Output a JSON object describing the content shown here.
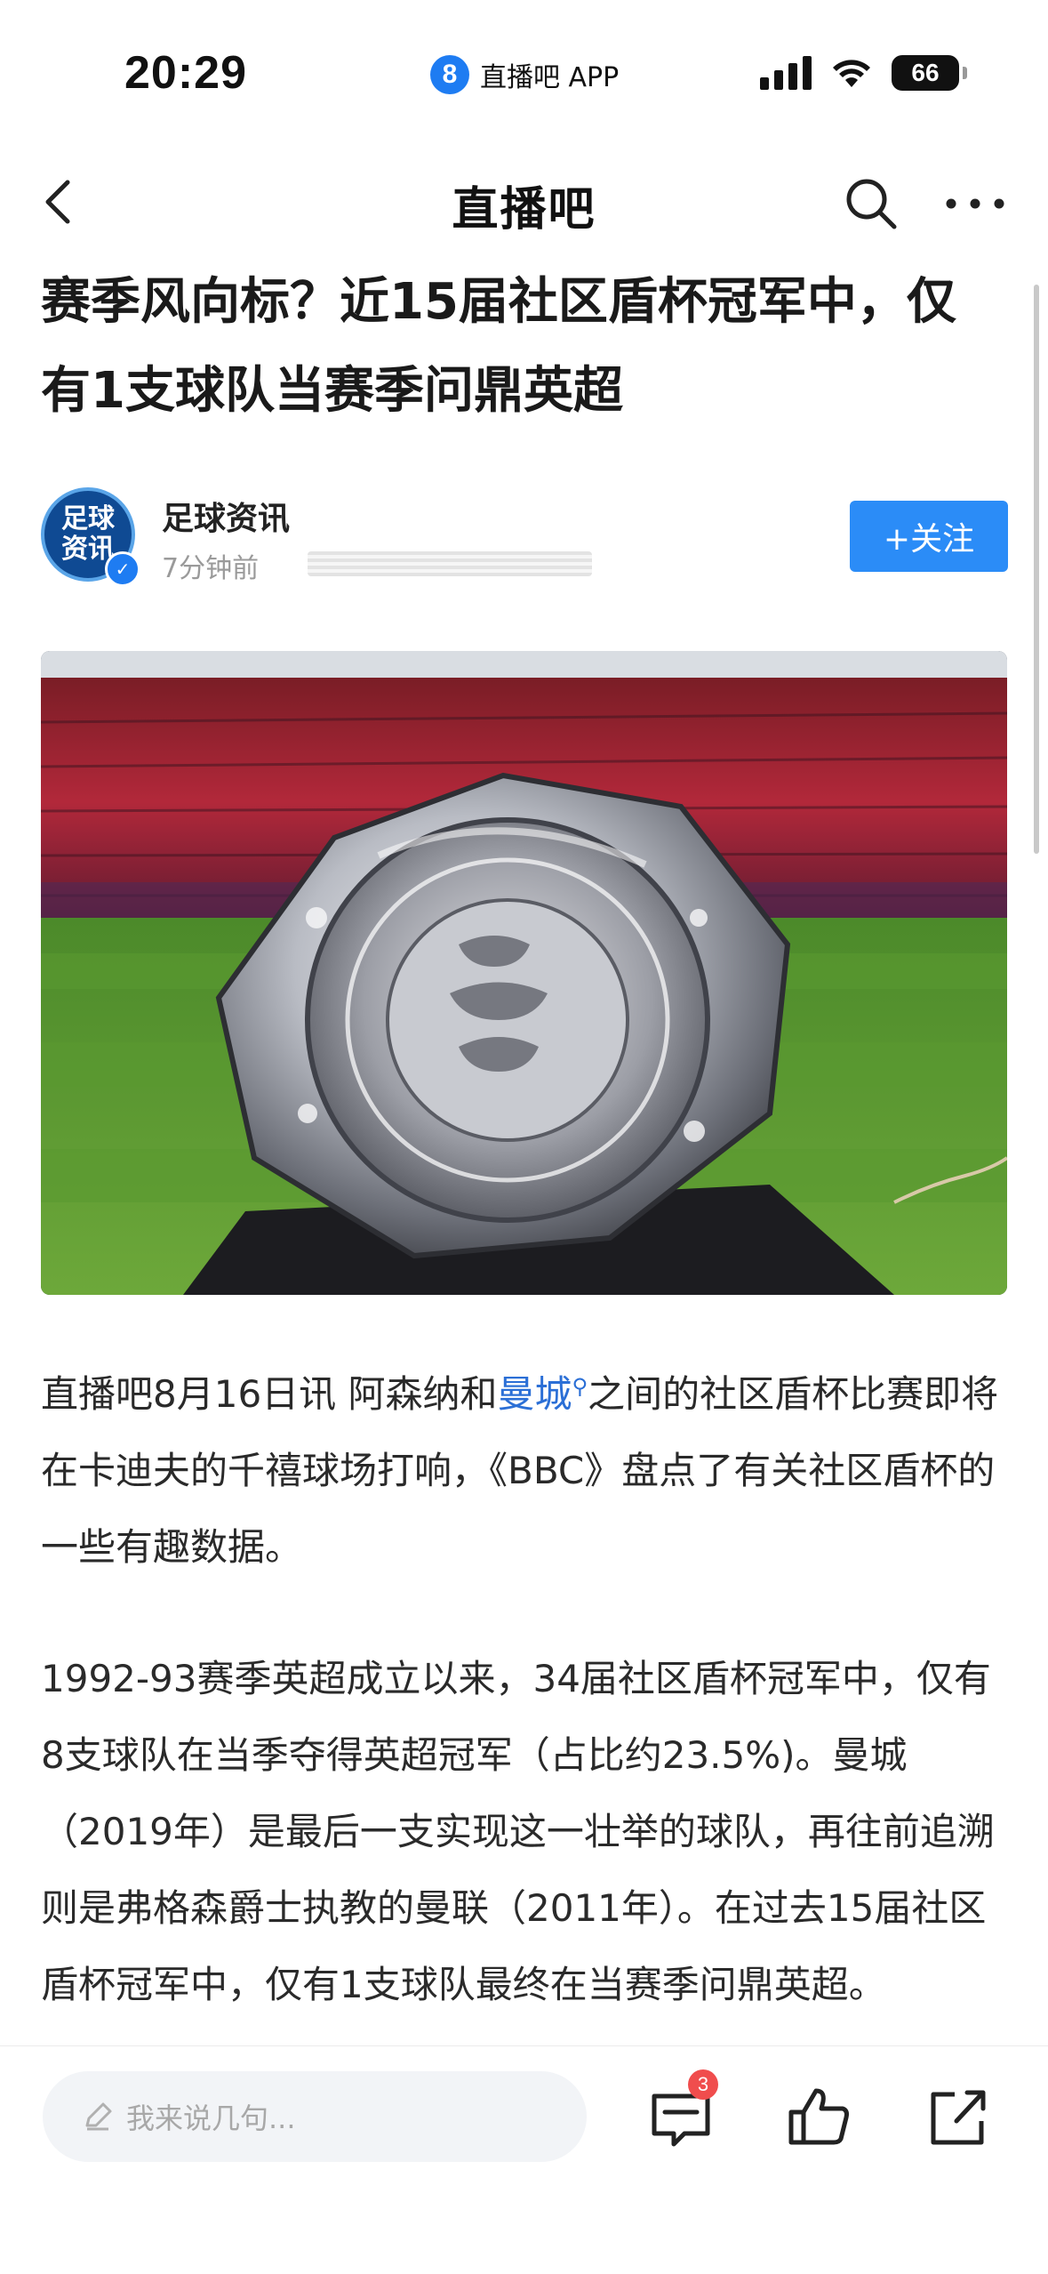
{
  "status_bar": {
    "time": "20:29",
    "app_badge": "8",
    "app_name": "直播吧 APP",
    "battery": "66"
  },
  "nav": {
    "title": "直播吧"
  },
  "article": {
    "title": "赛季风向标？近15届社区盾杯冠军中，仅有1支球队当赛季问鼎英超",
    "author": {
      "avatar_text_top": "足球",
      "avatar_text_bottom": "资讯",
      "name": "足球资讯",
      "time": "7分钟前"
    },
    "follow_label": "+关注",
    "paragraphs": {
      "p1_before_link": "直播吧8月16日讯 阿森纳和",
      "p1_link": "曼城",
      "p1_after_link": "之间的社区盾杯比赛即将在卡迪夫的千禧球场打响，《BBC》盘点了有关社区盾杯的一些有趣数据。",
      "p2": "1992-93赛季英超成立以来，34届社区盾杯冠军中，仅有8支球队在当季夺得英超冠军（占比约23.5%)。曼城（2019年）是最后一支实现这一壮举的球队，再往前追溯则是弗格森爵士执教的曼联（2011年）。在过去15届社区盾杯冠军中，仅有1支球队最终在当赛季问鼎英超。"
    }
  },
  "bottom_bar": {
    "comment_placeholder": "我来说几句...",
    "comment_count": "3"
  },
  "colors": {
    "accent": "#2b8cf7",
    "link": "#2b6fd6",
    "badge": "#f04d4d"
  }
}
